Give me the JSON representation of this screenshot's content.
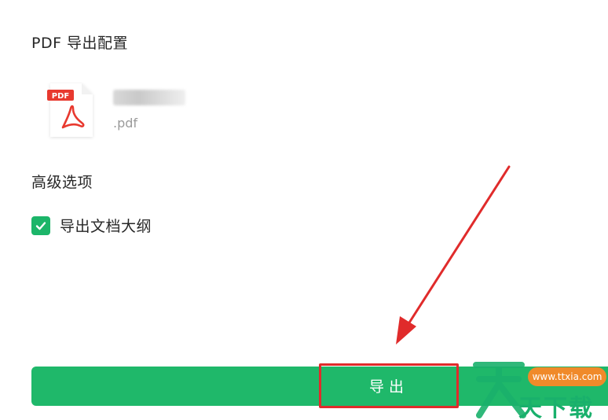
{
  "export_config": {
    "title": "PDF 导出配置",
    "file": {
      "icon_badge": "PDF",
      "extension": ".pdf"
    }
  },
  "advanced": {
    "title": "高级选项",
    "outline_checkbox": {
      "label": "导出文档大纲",
      "checked": true
    }
  },
  "export_button": {
    "label": "导出"
  },
  "watermark": {
    "url": "www.ttxia.com",
    "text": "天下载"
  },
  "colors": {
    "accent_green": "#1fb86a",
    "pdf_red": "#e8392f",
    "annotation_red": "#e02b2b",
    "watermark_orange": "#f08a2a"
  },
  "icons": [
    "pdf-file-icon",
    "check-icon"
  ]
}
